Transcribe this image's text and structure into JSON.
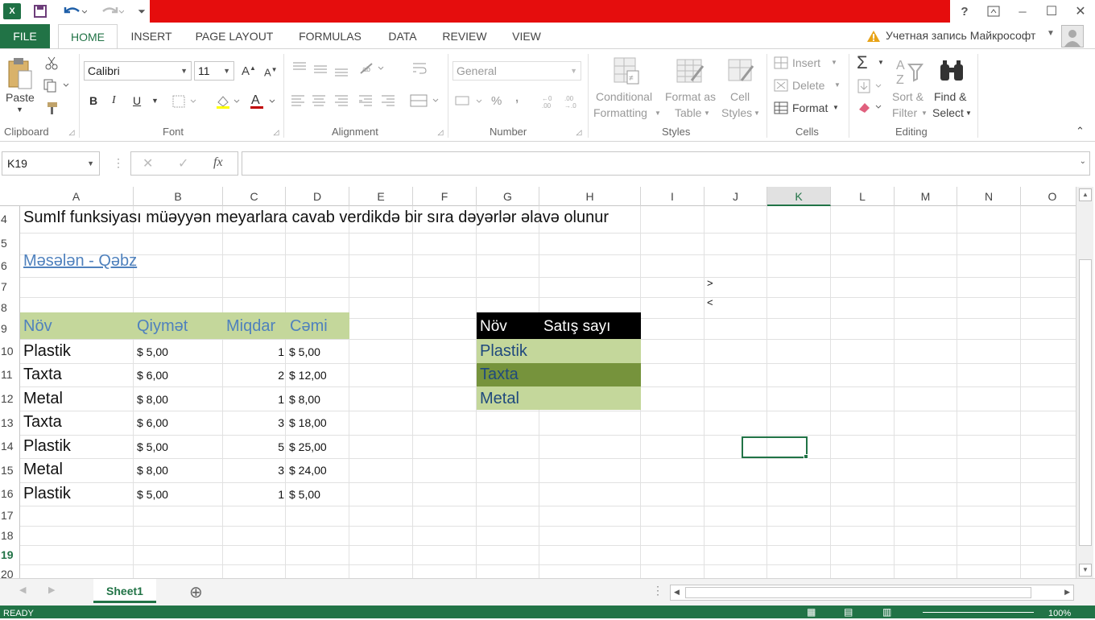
{
  "window": {
    "buttons": {
      "help": "?",
      "min": "─",
      "max": "☐",
      "close": "✕"
    }
  },
  "tabs": [
    "FILE",
    "HOME",
    "INSERT",
    "PAGE LAYOUT",
    "FORMULAS",
    "DATA",
    "REVIEW",
    "VIEW"
  ],
  "account": "Учетная запись Майкрософт",
  "ribbon": {
    "clipboard": {
      "paste": "Paste",
      "label": "Clipboard"
    },
    "font": {
      "name": "Calibri",
      "size": "11",
      "bold": "B",
      "italic": "I",
      "underline": "U",
      "label": "Font"
    },
    "alignment": {
      "label": "Alignment"
    },
    "number": {
      "format": "General",
      "percent": "%",
      "comma": ",",
      "label": "Number"
    },
    "styles": {
      "conditional1": "Conditional",
      "conditional2": "Formatting",
      "format_as1": "Format as",
      "format_as2": "Table",
      "cell1": "Cell",
      "cell2": "Styles",
      "label": "Styles"
    },
    "cells": {
      "insert": "Insert",
      "delete": "Delete",
      "format": "Format",
      "label": "Cells"
    },
    "editing": {
      "sort1": "Sort &",
      "sort2": "Filter",
      "find1": "Find &",
      "find2": "Select",
      "label": "Editing"
    }
  },
  "formula_bar": {
    "name_box": "K19",
    "fx": "fx",
    "value": ""
  },
  "columns": [
    "A",
    "B",
    "C",
    "D",
    "E",
    "F",
    "G",
    "H",
    "I",
    "J",
    "K",
    "L",
    "M",
    "N",
    "O"
  ],
  "rows": [
    "4",
    "5",
    "6",
    "7",
    "8",
    "9",
    "10",
    "11",
    "12",
    "13",
    "14",
    "15",
    "16",
    "17",
    "18",
    "19",
    "20"
  ],
  "cells": {
    "a4": "SumIf funksiyası müəyyən meyarlara cavab verdikdə bir sıra dəyərlər əlavə olunur",
    "a6": "Məsələn - Qəbz",
    "j7": ">",
    "j8": "<",
    "header": [
      "Növ",
      "Qiymət",
      "Miqdar",
      "Cəmi"
    ],
    "table": [
      [
        "Plastik",
        "$ 5,00",
        "1",
        "$ 5,00"
      ],
      [
        "Taxta",
        "$ 6,00",
        "2",
        "$ 12,00"
      ],
      [
        "Metal",
        "$ 8,00",
        "1",
        "$ 8,00"
      ],
      [
        "Taxta",
        "$ 6,00",
        "3",
        "$ 18,00"
      ],
      [
        "Plastik",
        "$ 5,00",
        "5",
        "$ 25,00"
      ],
      [
        "Metal",
        "$ 8,00",
        "3",
        "$ 24,00"
      ],
      [
        "Plastik",
        "$ 5,00",
        "1",
        "$ 5,00"
      ]
    ],
    "summary_header": [
      "Növ",
      "Satış sayı"
    ],
    "summary": [
      "Plastik",
      "Taxta",
      "Metal"
    ]
  },
  "sheet": {
    "tab": "Sheet1",
    "add": "⊕"
  },
  "status": {
    "ready": "READY",
    "zoom": "100%"
  },
  "colors": {
    "accent": "#217346",
    "green_light": "#c4d79b",
    "green_dark": "#76933c",
    "link": "#4f81bd"
  }
}
